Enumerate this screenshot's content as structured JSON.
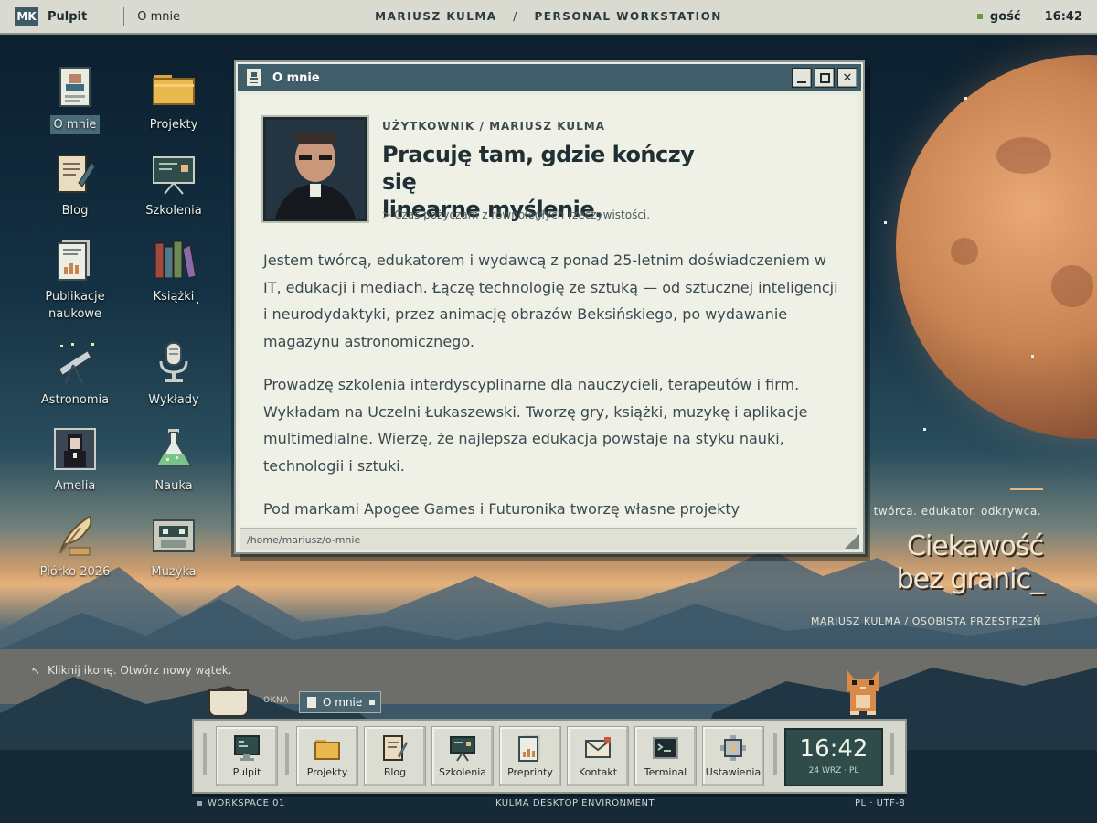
{
  "topbar": {
    "logo": "MK",
    "app_name": "Pulpit",
    "active_window": "O mnie",
    "center_name": "MARIUSZ KULMA",
    "center_sep": "/",
    "center_title": "PERSONAL WORKSTATION",
    "user": "gość",
    "time": "16:42"
  },
  "desktop_icons": [
    {
      "label": "O mnie"
    },
    {
      "label": "Projekty"
    },
    {
      "label": "Blog"
    },
    {
      "label": "Szkolenia"
    },
    {
      "label": "Publikacje naukowe"
    },
    {
      "label": "Książki"
    },
    {
      "label": "Astronomia"
    },
    {
      "label": "Wykłady"
    },
    {
      "label": "Amelia"
    },
    {
      "label": "Nauka"
    },
    {
      "label": "Piórko 2026"
    },
    {
      "label": "Muzyka"
    }
  ],
  "window": {
    "title": "O mnie",
    "kicker": "UŻYTKOWNIK / MARIUSZ KULMA",
    "headline_1": "Pracuję tam, gdzie kończy się",
    "headline_2": "linearne myślenie.",
    "tagline_prefix": ">",
    "tagline": "Czas pożyczam z równoległych rzeczywistości.",
    "paragraphs": [
      "Jestem twórcą, edukatorem i wydawcą z ponad 25-letnim doświadczeniem w IT, edukacji i mediach. Łączę technologię ze sztuką — od sztucznej inteligencji i neurodydaktyki, przez animację obrazów Beksińskiego, po wydawanie magazynu astronomicznego.",
      "Prowadzę szkolenia interdyscyplinarne dla nauczycieli, terapeutów i firm. Wykładam na Uczelni Łukaszewski. Tworzę gry, książki, muzykę i aplikacje multimedialne. Wierzę, że najlepsza edukacja powstaje na styku nauki, technologii i sztuki.",
      "Pod markami Apogee Games i Futuronika tworzę własne projekty interaktywne."
    ],
    "status_path": "/home/mariusz/o-mnie"
  },
  "right_panel": {
    "subtitle": "twórca. edukator. odkrywca.",
    "big_line_1": "Ciekawość",
    "big_line_2": "bez granic_",
    "footer": "MARIUSZ KULMA / OSOBISTA PRZESTRZEŃ"
  },
  "hint": "Kliknij ikonę. Otwórz nowy wątek.",
  "taskbar": {
    "windows_label": "OKNA",
    "open_window": "O mnie",
    "items": [
      {
        "label": "Pulpit"
      },
      {
        "label": "Projekty"
      },
      {
        "label": "Blog"
      },
      {
        "label": "Szkolenia"
      },
      {
        "label": "Preprinty"
      },
      {
        "label": "Kontakt"
      },
      {
        "label": "Terminal"
      },
      {
        "label": "Ustawienia"
      }
    ],
    "clock_time": "16:42",
    "clock_date": "24 WRZ · PL"
  },
  "footer": {
    "left": "WORKSPACE 01",
    "center": "KULMA DESKTOP ENVIRONMENT",
    "right": "PL · UTF-8"
  },
  "colors": {
    "accent": "#3f5e6a",
    "topbar": "#d9dbd0",
    "window_bg": "#eff0e6",
    "highlight": "#e2b884"
  }
}
